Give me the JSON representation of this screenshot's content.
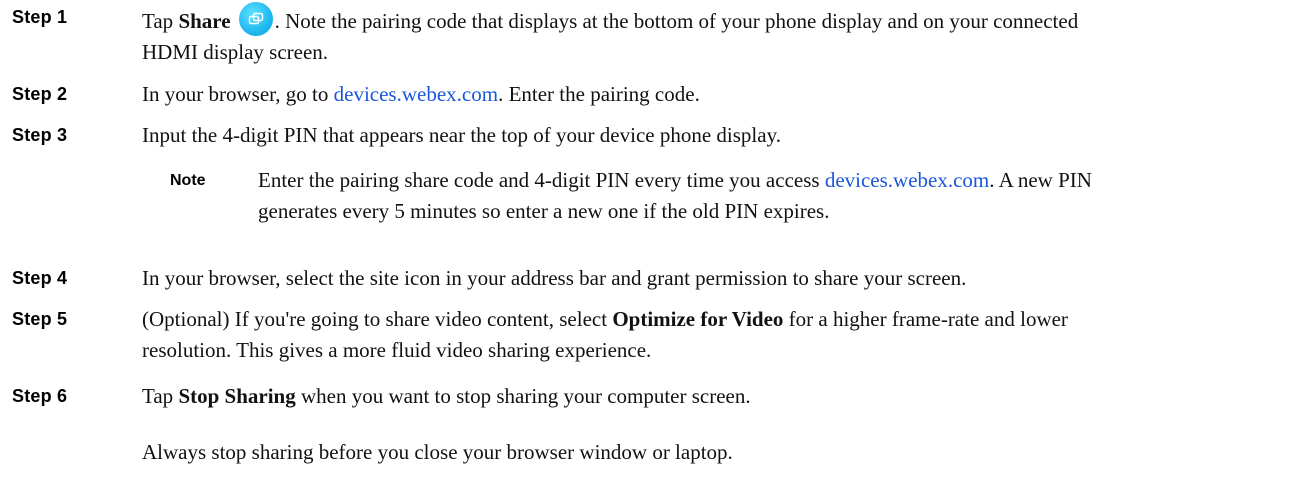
{
  "steps": [
    {
      "label": "Step 1",
      "pre": "Tap ",
      "bold": "Share",
      "icon": "share-icon",
      "post": ". Note the pairing code that displays at the bottom of your phone display and on your connected",
      "line2": "HDMI display screen."
    },
    {
      "label": "Step 2",
      "pre": "In your browser, go to ",
      "link": "devices.webex.com",
      "post": ". Enter the pairing code."
    },
    {
      "label": "Step 3",
      "text": "Input the 4-digit PIN that appears near the top of your device phone display."
    },
    {
      "label": "Step 4",
      "text": "In your browser, select the site icon in your address bar and grant permission to share your screen."
    },
    {
      "label": "Step 5",
      "pre": "(Optional) If you're going to share video content, select ",
      "bold": "Optimize for Video",
      "post": " for a higher frame-rate and lower",
      "line2": "resolution. This gives a more fluid video sharing experience."
    },
    {
      "label": "Step 6",
      "pre": "Tap ",
      "bold": "Stop Sharing",
      "post": " when you want to stop sharing your computer screen.",
      "extra": "Always stop sharing before you close your browser window or laptop."
    }
  ],
  "note": {
    "label": "Note",
    "pre": "Enter the pairing share code and 4-digit PIN every time you access ",
    "link": "devices.webex.com",
    "post": ". A new PIN",
    "line2": "generates every 5 minutes so enter a new one if the old PIN expires."
  },
  "colors": {
    "link": "#1a56db",
    "icon": "#1fb8f0"
  }
}
